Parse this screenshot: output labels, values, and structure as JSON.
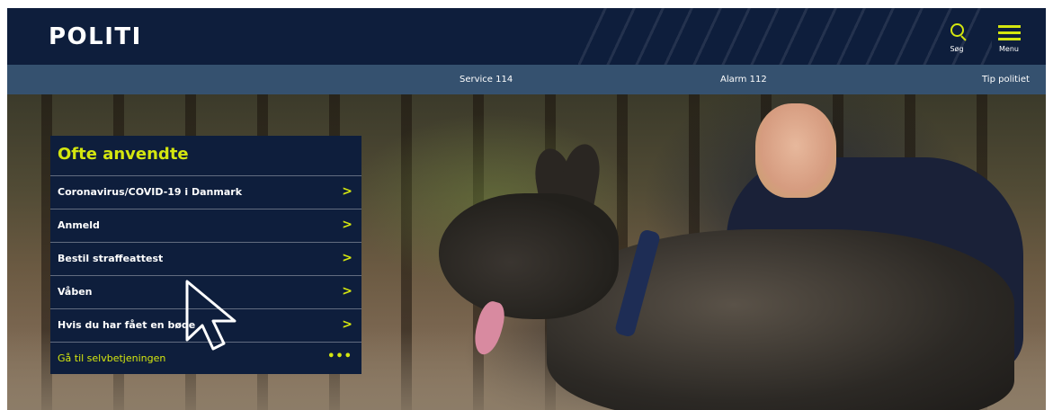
{
  "header": {
    "logo": "POLITI",
    "search_label": "Søg",
    "menu_label": "Menu",
    "accent_color": "#d4e60f",
    "bg_color": "#0e1e3c"
  },
  "subnav": {
    "items": [
      {
        "label": "Service 114"
      },
      {
        "label": "Alarm 112"
      },
      {
        "label": "Tip politiet"
      }
    ],
    "bg_color": "#35516f"
  },
  "quicklinks": {
    "title": "Ofte anvendte",
    "items": [
      {
        "label": "Coronavirus/COVID-19 i Danmark",
        "icon": "chevron-right-icon"
      },
      {
        "label": "Anmeld",
        "icon": "chevron-right-icon"
      },
      {
        "label": "Bestil straffeattest",
        "icon": "chevron-right-icon"
      },
      {
        "label": "Våben",
        "icon": "chevron-right-icon"
      },
      {
        "label": "Hvis du har fået en bøde",
        "icon": "chevron-right-icon"
      }
    ],
    "footer": {
      "label": "Gå til selvbetjeningen",
      "icon": "more-dots-icon"
    }
  }
}
